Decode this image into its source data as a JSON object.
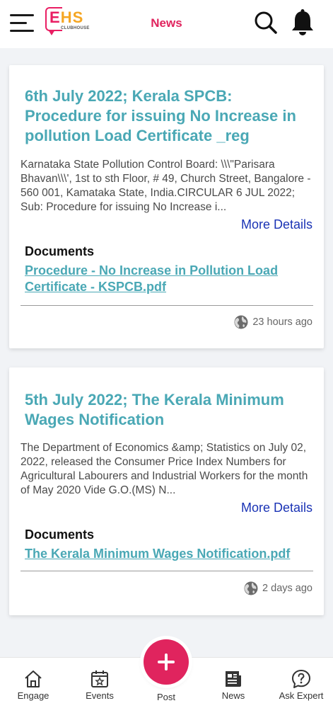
{
  "header": {
    "title": "News",
    "logo_text_e": "E",
    "logo_text_hs": "HS",
    "logo_subtext": "CLUBHOUSE"
  },
  "news": [
    {
      "title": "6th July 2022; Kerala SPCB: Procedure for issuing No Increase in pollution Load Certificate _reg",
      "summary": "Karnataka State Pollution Control Board: \\\\\\\"Parisara Bhavan\\\\\\', 1st to sth Floor, # 49, Church Street, Bangalore - 560 001, Kamataka State, India.CIRCULAR 6 JUL 2022; Sub: Procedure for issuing No Increase i...",
      "more_label": "More Details",
      "documents_label": "Documents",
      "document": "Procedure - No Increase in Pollution Load Certificate - KSPCB.pdf",
      "time": "23 hours ago"
    },
    {
      "title": "5th July 2022; The Kerala Minimum Wages Notification",
      "summary": "The Department of Economics &amp; Statistics on July 02, 2022, released the Consumer Price Index Numbers for Agricultural Labourers and Industrial Workers for the month of May 2020 Vide G.O.(MS) N...",
      "more_label": "More Details",
      "documents_label": "Documents",
      "document": "The Kerala Minimum Wages Notification.pdf",
      "time": "2 days ago"
    }
  ],
  "bottom_nav": {
    "engage": "Engage",
    "events": "Events",
    "post": "Post",
    "news": "News",
    "ask_expert": "Ask Expert"
  },
  "colors": {
    "accent": "#e0245e",
    "title_teal": "#4aa8b5",
    "link_blue": "#1a33b5"
  },
  "icons": [
    "menu-icon",
    "search-icon",
    "bell-icon",
    "globe-icon",
    "home-icon",
    "calendar-star-icon",
    "plus-icon",
    "newspaper-icon",
    "question-bubble-icon"
  ]
}
